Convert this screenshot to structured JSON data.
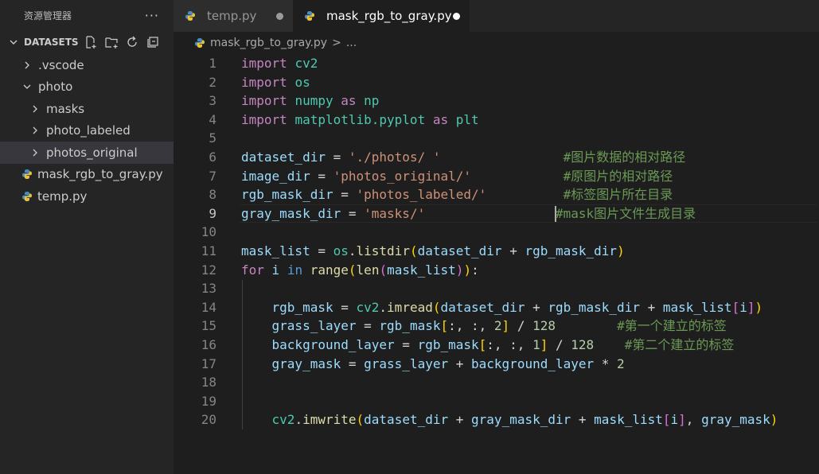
{
  "sidebar": {
    "title": "资源管理器",
    "more": "···",
    "workspace": "DATASETS",
    "items": [
      {
        "label": ".vscode",
        "kind": "folder-collapsed",
        "depth": 1
      },
      {
        "label": "photo",
        "kind": "folder-expanded",
        "depth": 1
      },
      {
        "label": "masks",
        "kind": "folder-collapsed",
        "depth": 2
      },
      {
        "label": "photo_labeled",
        "kind": "folder-collapsed",
        "depth": 2
      },
      {
        "label": "photos_original",
        "kind": "folder-collapsed",
        "depth": 2,
        "selected": true
      },
      {
        "label": "mask_rgb_to_gray.py",
        "kind": "python-file",
        "depth": 1
      },
      {
        "label": "temp.py",
        "kind": "python-file",
        "depth": 1
      }
    ]
  },
  "tabs": [
    {
      "label": "temp.py",
      "active": false,
      "dirty": true
    },
    {
      "label": "mask_rgb_to_gray.py",
      "active": true,
      "dirty": true
    }
  ],
  "breadcrumb": {
    "file": "mask_rgb_to_gray.py",
    "sep": ">",
    "more": "..."
  },
  "editor": {
    "current_line": 9,
    "lines": [
      {
        "n": "1",
        "tokens": [
          [
            "kw",
            "import"
          ],
          [
            "pl",
            " "
          ],
          [
            "mod",
            "cv2"
          ]
        ]
      },
      {
        "n": "2",
        "tokens": [
          [
            "kw",
            "import"
          ],
          [
            "pl",
            " "
          ],
          [
            "mod",
            "os"
          ]
        ]
      },
      {
        "n": "3",
        "tokens": [
          [
            "kw",
            "import"
          ],
          [
            "pl",
            " "
          ],
          [
            "mod",
            "numpy"
          ],
          [
            "pl",
            " "
          ],
          [
            "kw",
            "as"
          ],
          [
            "pl",
            " "
          ],
          [
            "mod",
            "np"
          ]
        ]
      },
      {
        "n": "4",
        "tokens": [
          [
            "kw",
            "import"
          ],
          [
            "pl",
            " "
          ],
          [
            "mod",
            "matplotlib.pyplot"
          ],
          [
            "pl",
            " "
          ],
          [
            "kw",
            "as"
          ],
          [
            "pl",
            " "
          ],
          [
            "mod",
            "plt"
          ]
        ]
      },
      {
        "n": "5",
        "tokens": []
      },
      {
        "n": "6",
        "tokens": [
          [
            "var",
            "dataset_dir"
          ],
          [
            "pl",
            " = "
          ],
          [
            "str",
            "'./photos/ '"
          ],
          [
            "pl",
            "                "
          ],
          [
            "cm",
            "#图片数据的相对路径"
          ]
        ]
      },
      {
        "n": "7",
        "tokens": [
          [
            "var",
            "image_dir"
          ],
          [
            "pl",
            " = "
          ],
          [
            "str",
            "'photos_original/'"
          ],
          [
            "pl",
            "            "
          ],
          [
            "cm",
            "#原图片的相对路径"
          ]
        ]
      },
      {
        "n": "8",
        "tokens": [
          [
            "var",
            "rgb_mask_dir"
          ],
          [
            "pl",
            " = "
          ],
          [
            "str",
            "'photos_labeled/'"
          ],
          [
            "pl",
            "          "
          ],
          [
            "cm",
            "#标签图片所在目录"
          ]
        ]
      },
      {
        "n": "9",
        "tokens": [
          [
            "var",
            "gray_mask_dir"
          ],
          [
            "pl",
            " = "
          ],
          [
            "str",
            "'masks/'"
          ],
          [
            "pl",
            "                 "
          ],
          [
            "cm",
            "#mask图片文件生成目录"
          ]
        ]
      },
      {
        "n": "10",
        "tokens": []
      },
      {
        "n": "11",
        "tokens": [
          [
            "var",
            "mask_list"
          ],
          [
            "pl",
            " = "
          ],
          [
            "mod",
            "os"
          ],
          [
            "pl",
            "."
          ],
          [
            "fn",
            "listdir"
          ],
          [
            "br1",
            "("
          ],
          [
            "var",
            "dataset_dir"
          ],
          [
            "pl",
            " + "
          ],
          [
            "var",
            "rgb_mask_dir"
          ],
          [
            "br1",
            ")"
          ]
        ]
      },
      {
        "n": "12",
        "tokens": [
          [
            "kw",
            "for"
          ],
          [
            "pl",
            " "
          ],
          [
            "var",
            "i"
          ],
          [
            "pl",
            " "
          ],
          [
            "kb",
            "in"
          ],
          [
            "pl",
            " "
          ],
          [
            "fn",
            "range"
          ],
          [
            "br1",
            "("
          ],
          [
            "fn",
            "len"
          ],
          [
            "br2",
            "("
          ],
          [
            "var",
            "mask_list"
          ],
          [
            "br2",
            ")"
          ],
          [
            "br1",
            ")"
          ],
          [
            "pl",
            ":"
          ]
        ]
      },
      {
        "n": "13",
        "tokens": []
      },
      {
        "n": "14",
        "tokens": [
          [
            "pl",
            "    "
          ],
          [
            "var",
            "rgb_mask"
          ],
          [
            "pl",
            " = "
          ],
          [
            "mod",
            "cv2"
          ],
          [
            "pl",
            "."
          ],
          [
            "fn",
            "imread"
          ],
          [
            "br1",
            "("
          ],
          [
            "var",
            "dataset_dir"
          ],
          [
            "pl",
            " + "
          ],
          [
            "var",
            "rgb_mask_dir"
          ],
          [
            "pl",
            " + "
          ],
          [
            "var",
            "mask_list"
          ],
          [
            "br2",
            "["
          ],
          [
            "var",
            "i"
          ],
          [
            "br2",
            "]"
          ],
          [
            "br1",
            ")"
          ]
        ]
      },
      {
        "n": "15",
        "tokens": [
          [
            "pl",
            "    "
          ],
          [
            "var",
            "grass_layer"
          ],
          [
            "pl",
            " = "
          ],
          [
            "var",
            "rgb_mask"
          ],
          [
            "br1",
            "["
          ],
          [
            "pl",
            ":, :, "
          ],
          [
            "num",
            "2"
          ],
          [
            "br1",
            "]"
          ],
          [
            "pl",
            " / "
          ],
          [
            "num",
            "128"
          ],
          [
            "pl",
            "        "
          ],
          [
            "cm",
            "#第一个建立的标签"
          ]
        ]
      },
      {
        "n": "16",
        "tokens": [
          [
            "pl",
            "    "
          ],
          [
            "var",
            "background_layer"
          ],
          [
            "pl",
            " = "
          ],
          [
            "var",
            "rgb_mask"
          ],
          [
            "br1",
            "["
          ],
          [
            "pl",
            ":, :, "
          ],
          [
            "num",
            "1"
          ],
          [
            "br1",
            "]"
          ],
          [
            "pl",
            " / "
          ],
          [
            "num",
            "128"
          ],
          [
            "pl",
            "    "
          ],
          [
            "cm",
            "#第二个建立的标签"
          ]
        ]
      },
      {
        "n": "17",
        "tokens": [
          [
            "pl",
            "    "
          ],
          [
            "var",
            "gray_mask"
          ],
          [
            "pl",
            " = "
          ],
          [
            "var",
            "grass_layer"
          ],
          [
            "pl",
            " + "
          ],
          [
            "var",
            "background_layer"
          ],
          [
            "pl",
            " * "
          ],
          [
            "num",
            "2"
          ]
        ]
      },
      {
        "n": "18",
        "tokens": []
      },
      {
        "n": "19",
        "tokens": []
      },
      {
        "n": "20",
        "tokens": [
          [
            "pl",
            "    "
          ],
          [
            "mod",
            "cv2"
          ],
          [
            "pl",
            "."
          ],
          [
            "fn",
            "imwrite"
          ],
          [
            "br1",
            "("
          ],
          [
            "var",
            "dataset_dir"
          ],
          [
            "pl",
            " + "
          ],
          [
            "var",
            "gray_mask_dir"
          ],
          [
            "pl",
            " + "
          ],
          [
            "var",
            "mask_list"
          ],
          [
            "br2",
            "["
          ],
          [
            "var",
            "i"
          ],
          [
            "br2",
            "]"
          ],
          [
            "pl",
            ", "
          ],
          [
            "var",
            "gray_mask"
          ],
          [
            "br1",
            ")"
          ]
        ]
      }
    ]
  }
}
